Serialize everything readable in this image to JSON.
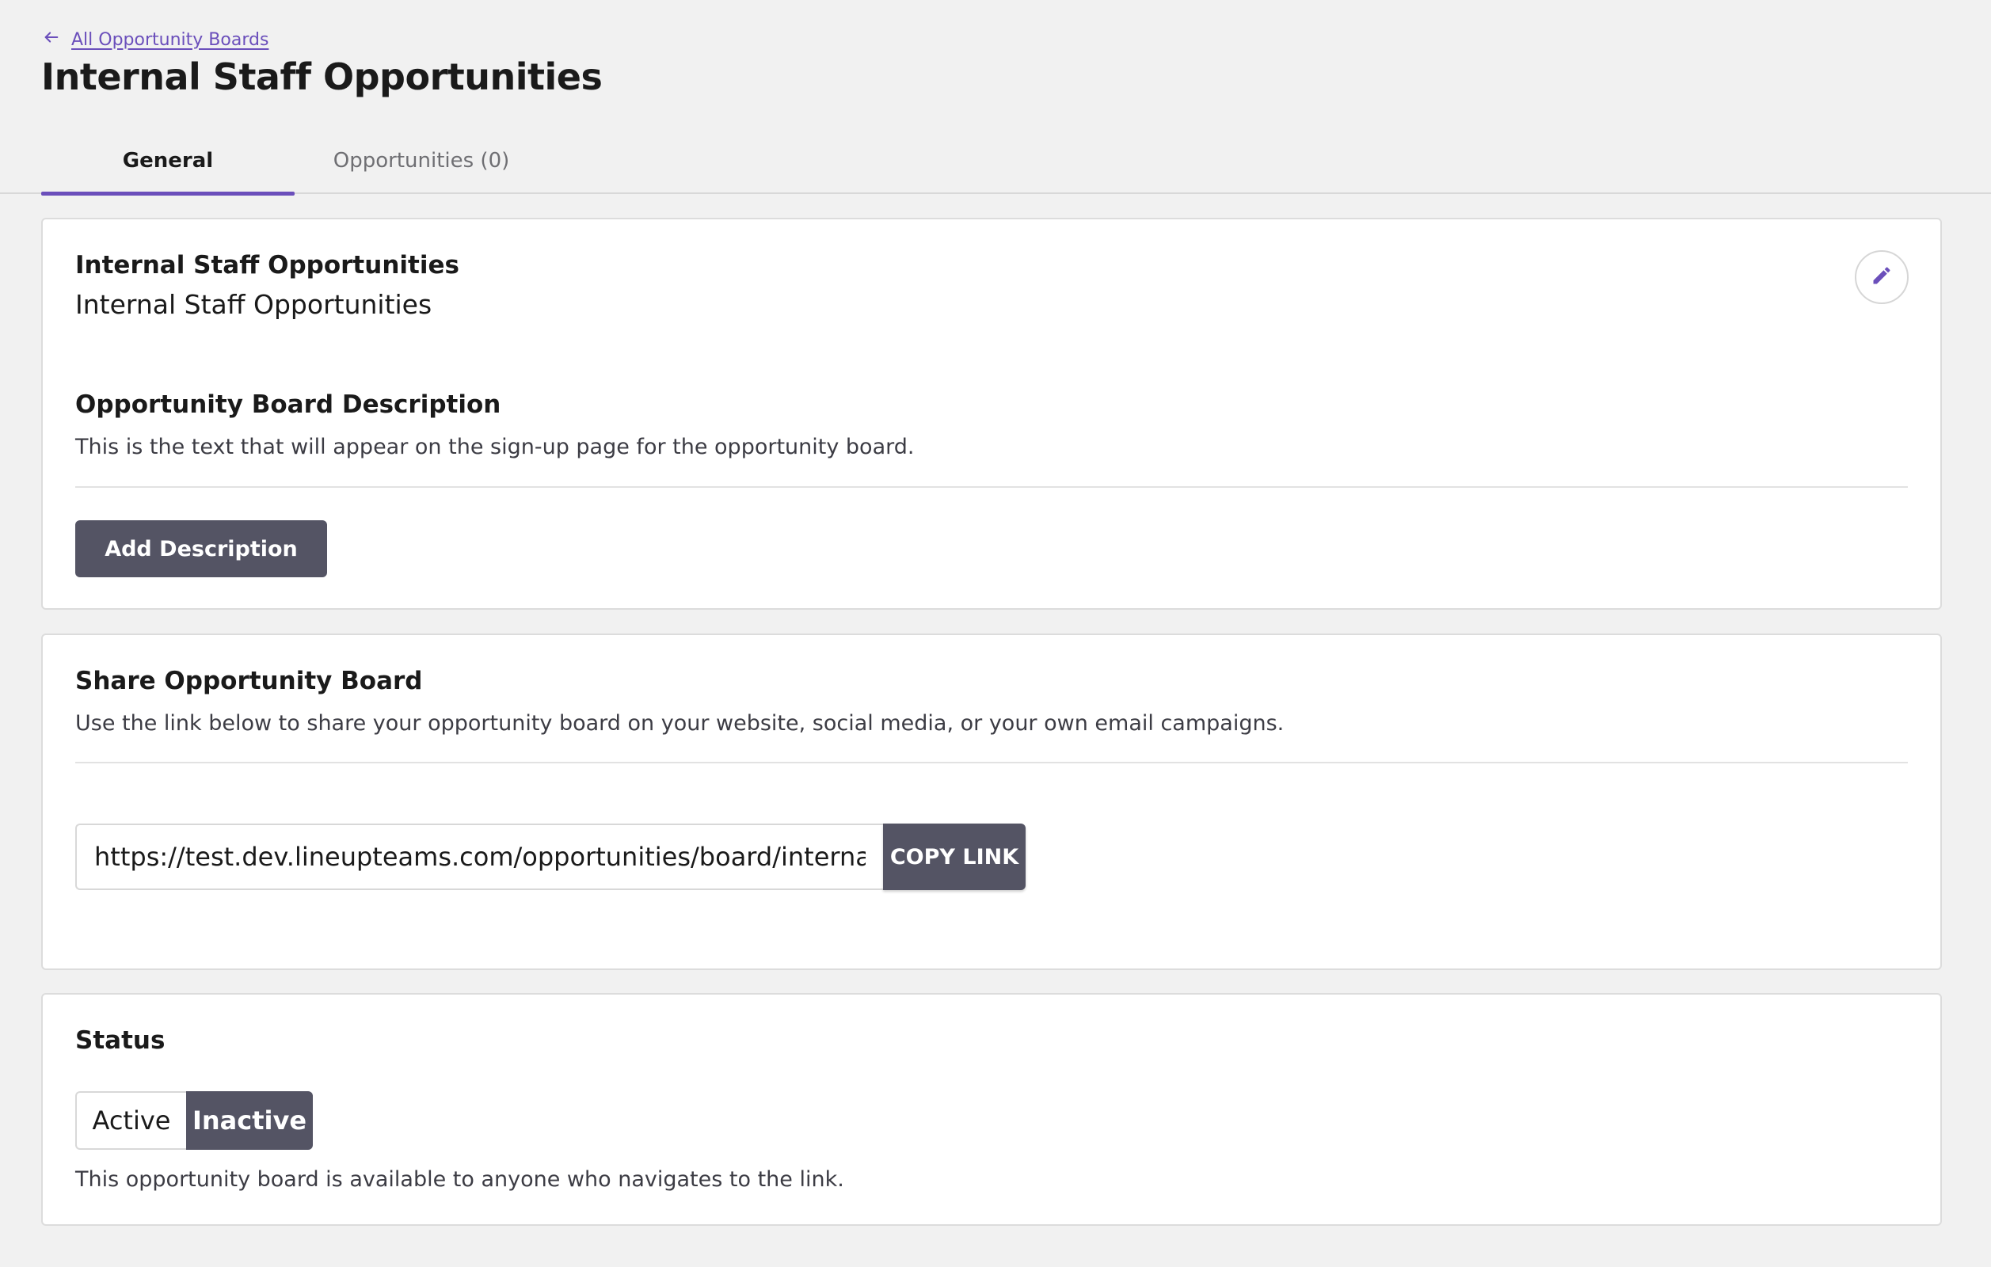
{
  "header": {
    "back_link": "All Opportunity Boards",
    "title": "Internal Staff Opportunities"
  },
  "tabs": [
    {
      "label": "General",
      "selected": true
    },
    {
      "label": "Opportunities (0)",
      "selected": false
    }
  ],
  "general_card": {
    "name_heading": "Internal Staff Opportunities",
    "name_value": "Internal Staff Opportunities",
    "description_heading": "Opportunity Board Description",
    "description_help": "This is the text that will appear on the sign-up page for the opportunity board.",
    "add_description_button": "Add Description",
    "edit_icon": "pencil-icon"
  },
  "share_card": {
    "heading": "Share Opportunity Board",
    "help": "Use the link below to share your opportunity board on your website, social media, or your own email campaigns.",
    "link_value": "https://test.dev.lineupteams.com/opportunities/board/internal-staff-opportunities",
    "copy_button": "COPY LINK"
  },
  "status_card": {
    "heading": "Status",
    "options": [
      "Active",
      "Inactive"
    ],
    "selected": "Inactive",
    "help": "This opportunity board is available to anyone who navigates to the link."
  },
  "colors": {
    "accent": "#6b4fbb",
    "dark_button": "#545464",
    "background": "#f1f1f1"
  }
}
